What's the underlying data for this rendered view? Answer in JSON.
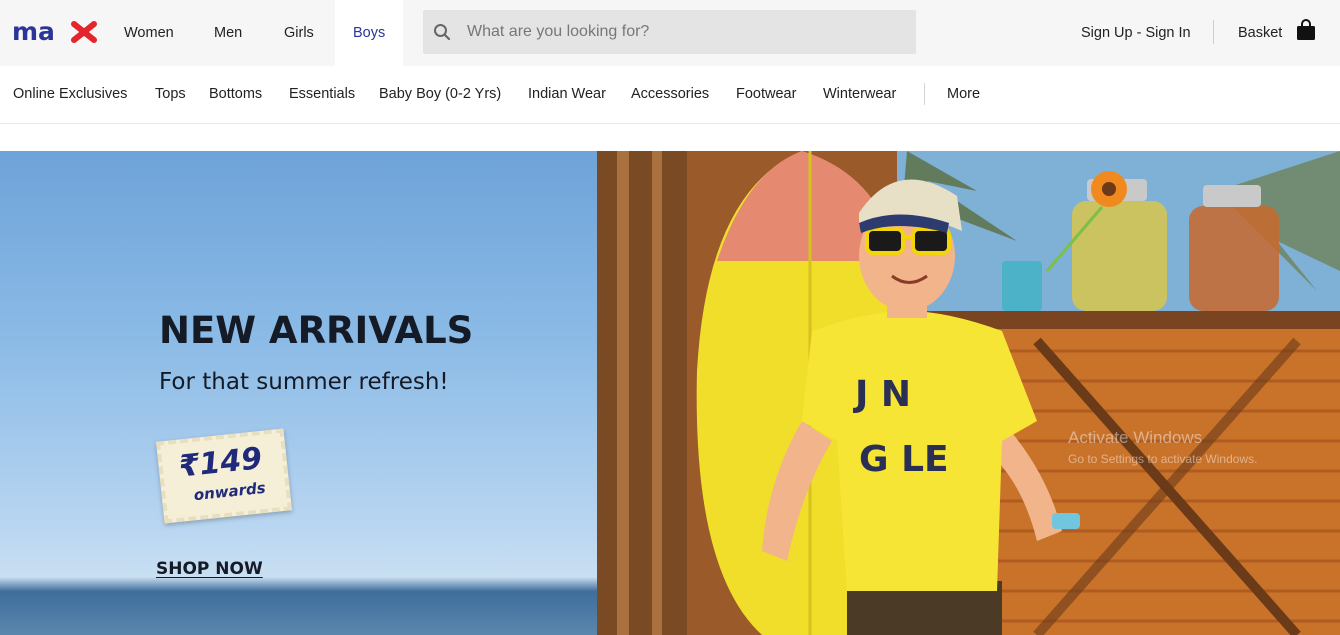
{
  "header": {
    "logo_text": "max",
    "categories": [
      {
        "label": "Women",
        "active": false
      },
      {
        "label": "Men",
        "active": false
      },
      {
        "label": "Girls",
        "active": false
      },
      {
        "label": "Boys",
        "active": true
      }
    ],
    "search": {
      "placeholder": "What are you looking for?",
      "value": ""
    },
    "signin_label": "Sign Up - Sign In",
    "basket_label": "Basket"
  },
  "subnav": {
    "items": [
      "Online Exclusives",
      "Tops",
      "Bottoms",
      "Essentials",
      "Baby Boy (0-2 Yrs)",
      "Indian Wear",
      "Accessories",
      "Footwear",
      "Winterwear"
    ],
    "more_label": "More"
  },
  "hero": {
    "headline": "NEW ARRIVALS",
    "subline": "For that summer refresh!",
    "price": "₹149",
    "price_suffix": "onwards",
    "cta": "SHOP NOW",
    "shirt_text": "JUNGLE"
  },
  "watermark": {
    "title": "Activate Windows",
    "subtitle": "Go to Settings to activate Windows."
  },
  "colors": {
    "brand_blue": "#2b3597",
    "logo_red": "#e4262c",
    "active_tab": "#2b3597"
  }
}
